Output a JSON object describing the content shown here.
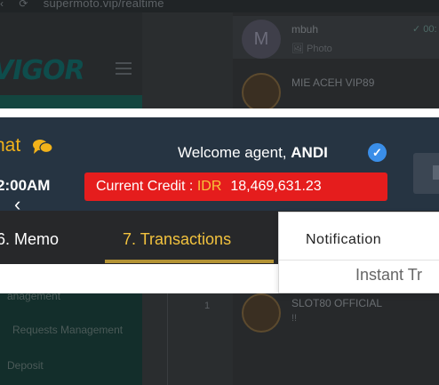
{
  "browser": {
    "url": "supermoto.vip/realtime"
  },
  "background": {
    "logo": "VIGOR",
    "sidebar_items": [
      "Requests Management",
      "Deposit"
    ],
    "partial_item": "anagement",
    "table_cell": "1"
  },
  "chats": [
    {
      "avatar_letter": "M",
      "name": "mbuh",
      "preview": "Photo",
      "status": "✓ 00:"
    },
    {
      "name": "MIE ACEH VIP89",
      "preview": ""
    },
    {
      "name": "SLOT80 OFFICIAL",
      "preview": "!!"
    }
  ],
  "header": {
    "chat_label": "hat",
    "time": "2:00AM",
    "welcome_prefix": "Welcome agent, ",
    "agent_name": "ANDI",
    "credit_label": "Current Credit : ",
    "currency": "IDR",
    "credit_amount": "18,469,631.23"
  },
  "tabs": [
    {
      "label": "6. Memo",
      "active": false
    },
    {
      "label": "7. Transactions",
      "active": true
    }
  ],
  "notification": {
    "title": "Notification",
    "item": "Instant Tr"
  },
  "colors": {
    "header_bg": "#263442",
    "credit_bg": "#e51d1d",
    "currency": "#f6c43a",
    "active_tab": "#f2c23e",
    "verified": "#3a8ee8"
  }
}
